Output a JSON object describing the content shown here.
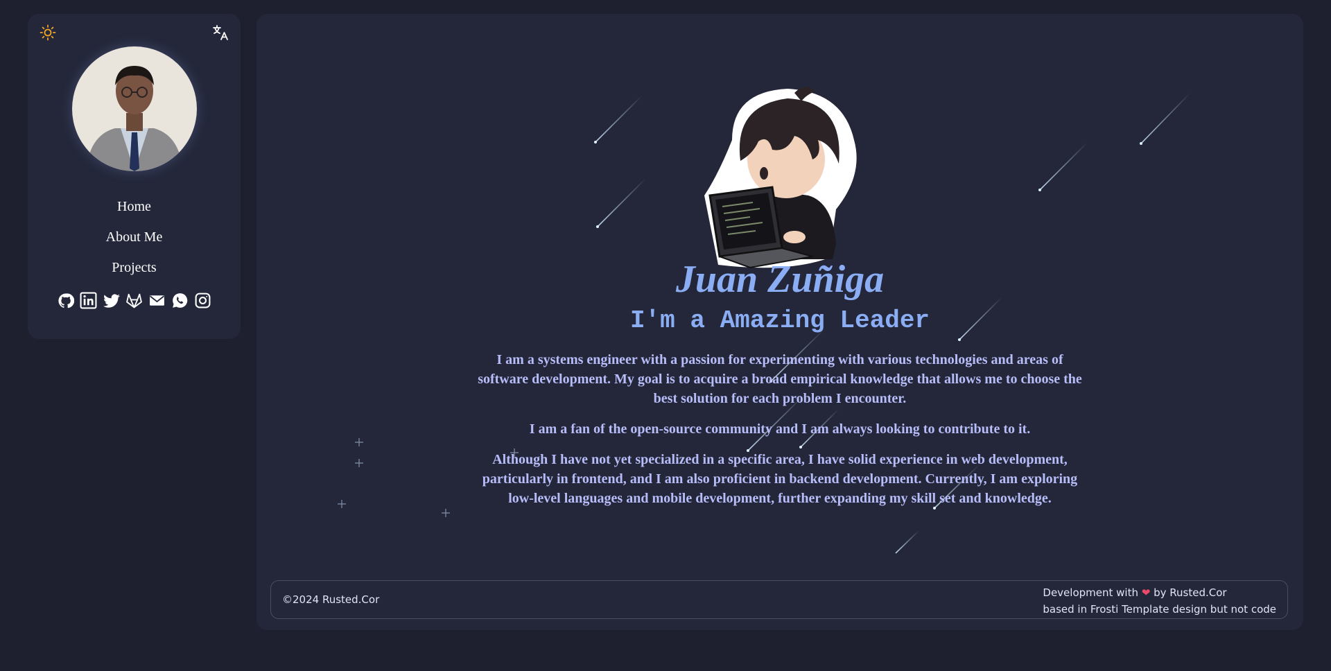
{
  "theme": {
    "accent": "#8aadf4",
    "background": "#1e2030",
    "card": "#24273a",
    "sun_color": "#f5a623",
    "heart_color": "#ed4a6a"
  },
  "sidebar": {
    "icons": {
      "theme_toggle": "sun-icon",
      "language": "translate-icon"
    },
    "nav": [
      {
        "label": "Home"
      },
      {
        "label": "About Me"
      },
      {
        "label": "Projects"
      }
    ],
    "socials": [
      "github-icon",
      "linkedin-icon",
      "twitter-icon",
      "gitlab-icon",
      "mail-icon",
      "whatsapp-icon",
      "instagram-icon"
    ]
  },
  "hero": {
    "name": "Juan Zuñiga",
    "tagline": "I'm a Amazing Leader",
    "bio": [
      "I am a systems engineer with a passion for experimenting with various technologies and areas of software development. My goal is to acquire a broad empirical knowledge that allows me to choose the best solution for each problem I encounter.",
      "I am a fan of the open-source community and I am always looking to contribute to it.",
      "Although I have not yet specialized in a specific area, I have solid experience in web development, particularly in frontend, and I am also proficient in backend development. Currently, I am exploring low-level languages and mobile development, further expanding my skill set and knowledge."
    ]
  },
  "footer": {
    "copyright": "©2024 Rusted.Cor",
    "credit_prefix": "Development with",
    "heart": "❤",
    "credit_suffix": "by Rusted.Cor",
    "credit_line2": "based in Frosti Template design but not code"
  }
}
